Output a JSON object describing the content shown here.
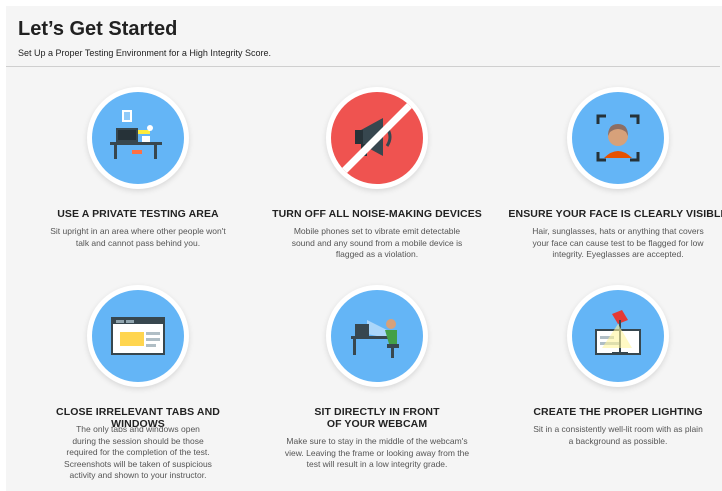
{
  "header": {
    "title": "Let’s Get Started",
    "subtitle": "Set Up a Proper Testing Environment for a High Integrity Score."
  },
  "colors": {
    "circle_blue": "#64b5f6",
    "circle_red": "#ef5350",
    "background": "#f5f5f5"
  },
  "cards": [
    {
      "icon": "desk-workspace-icon",
      "title": "USE A PRIVATE TESTING AREA",
      "description": "Sit upright in an area where other people won't talk and cannot pass behind you."
    },
    {
      "icon": "no-megaphone-icon",
      "title": "TURN OFF ALL NOISE-MAKING DEVICES",
      "description": "Mobile phones set to vibrate emit detectable sound and any sound from a mobile device is flagged as a violation."
    },
    {
      "icon": "face-frame-icon",
      "title": "ENSURE YOUR FACE IS CLEARLY VISIBLE",
      "description": "Hair, sunglasses, hats or anything that covers your face can cause test to be flagged for low integrity. Eyeglasses are accepted."
    },
    {
      "icon": "browser-tabs-icon",
      "title": "CLOSE IRRELEVANT TABS AND WINDOWS",
      "description": "The only tabs and windows open during the session should be those required for the completion of the test. Screenshots will be taken of suspicious activity and shown to your instructor."
    },
    {
      "icon": "webcam-desk-icon",
      "title": "SIT DIRECTLY IN FRONT OF YOUR WEBCAM",
      "description": "Make sure to stay in the middle of the webcam's view. Leaving the frame or looking away from the test will result in a low integrity grade."
    },
    {
      "icon": "desk-lamp-icon",
      "title": "CREATE THE PROPER LIGHTING",
      "description": "Sit in a consistently well-lit room with as plain a background as possible."
    }
  ]
}
